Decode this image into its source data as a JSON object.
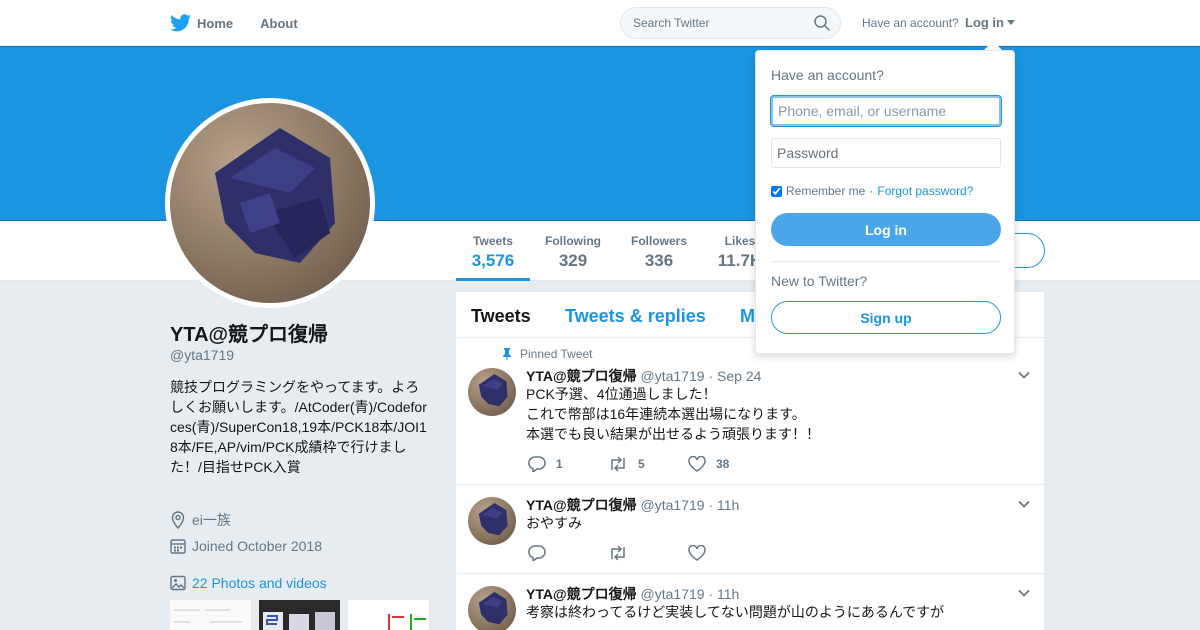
{
  "nav": {
    "home_label": "Home",
    "about_label": "About",
    "search_placeholder": "Search Twitter",
    "have_account": "Have an account?",
    "login_label": "Log in"
  },
  "colors": {
    "brand": "#1b95e0",
    "banner": "#1b95e0",
    "login_button": "#4aa6e8"
  },
  "profile": {
    "name": "YTA@競プロ復帰",
    "handle": "@yta1719",
    "bio": "競技プログラミングをやってます。よろしくお願いします。/AtCoder(青)/Codeforces(青)/SuperCon18,19本/PCK18本/JOI18本/FE,AP/vim/PCK成績枠で行けました！/目指せPCK入賞",
    "location": "ei一族",
    "joined": "Joined October 2018",
    "photos_link": "22 Photos and videos"
  },
  "stats": [
    {
      "label": "Tweets",
      "value": "3,576"
    },
    {
      "label": "Following",
      "value": "329"
    },
    {
      "label": "Followers",
      "value": "336"
    },
    {
      "label": "Likes",
      "value": "11.7K"
    }
  ],
  "timeline": {
    "tabs": [
      "Tweets",
      "Tweets & replies",
      "Media"
    ],
    "pinned_label": "Pinned Tweet",
    "tweets": [
      {
        "name": "YTA@競プロ復帰",
        "handle": "@yta1719",
        "time": "Sep 24",
        "lines": [
          "PCK予選、4位通過しました！",
          "これで幣部は16年連続本選出場になります。",
          "本選でも良い結果が出せるよう頑張ります！！"
        ],
        "replies": "1",
        "retweets": "5",
        "likes": "38"
      },
      {
        "name": "YTA@競プロ復帰",
        "handle": "@yta1719",
        "time": "11h",
        "lines": [
          "おやすみ"
        ],
        "replies": "",
        "retweets": "",
        "likes": ""
      },
      {
        "name": "YTA@競プロ復帰",
        "handle": "@yta1719",
        "time": "11h",
        "lines": [
          "考察は終わってるけど実装してない問題が山のようにあるんですが"
        ],
        "replies": "",
        "retweets": "",
        "likes": ""
      }
    ]
  },
  "login_dropdown": {
    "heading": "Have an account?",
    "username_placeholder": "Phone, email, or username",
    "password_placeholder": "Password",
    "remember_me": "Remember me",
    "separator": "·",
    "forgot_password": "Forgot password?",
    "login_button": "Log in",
    "new_to_twitter": "New to Twitter?",
    "signup_button": "Sign up"
  }
}
